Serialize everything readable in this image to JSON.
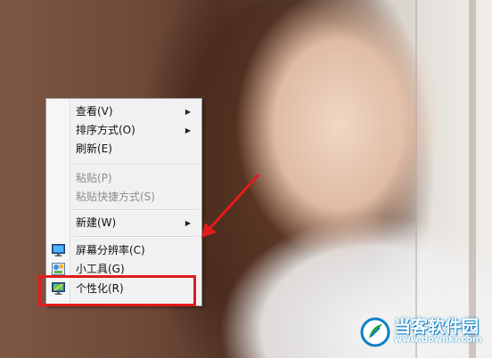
{
  "context_menu": {
    "items": [
      {
        "label": "查看(V)",
        "has_submenu": true,
        "enabled": true
      },
      {
        "label": "排序方式(O)",
        "has_submenu": true,
        "enabled": true
      },
      {
        "label": "刷新(E)",
        "has_submenu": false,
        "enabled": true
      },
      {
        "label": "粘贴(P)",
        "has_submenu": false,
        "enabled": false
      },
      {
        "label": "粘贴快捷方式(S)",
        "has_submenu": false,
        "enabled": false
      },
      {
        "label": "新建(W)",
        "has_submenu": true,
        "enabled": true
      },
      {
        "label": "屏幕分辨率(C)",
        "has_submenu": false,
        "enabled": true,
        "icon": "monitor-icon"
      },
      {
        "label": "小工具(G)",
        "has_submenu": false,
        "enabled": true,
        "icon": "gadgets-icon"
      },
      {
        "label": "个性化(R)",
        "has_submenu": false,
        "enabled": true,
        "icon": "personalize-icon",
        "highlighted": true
      }
    ],
    "submenu_arrow": "▶"
  },
  "annotation": {
    "box_color": "#e21b1b",
    "arrow_color": "#e21b1b"
  },
  "watermark": {
    "title": "当客软件园",
    "url": "www.downkr.com",
    "color": "#0d80c7"
  }
}
